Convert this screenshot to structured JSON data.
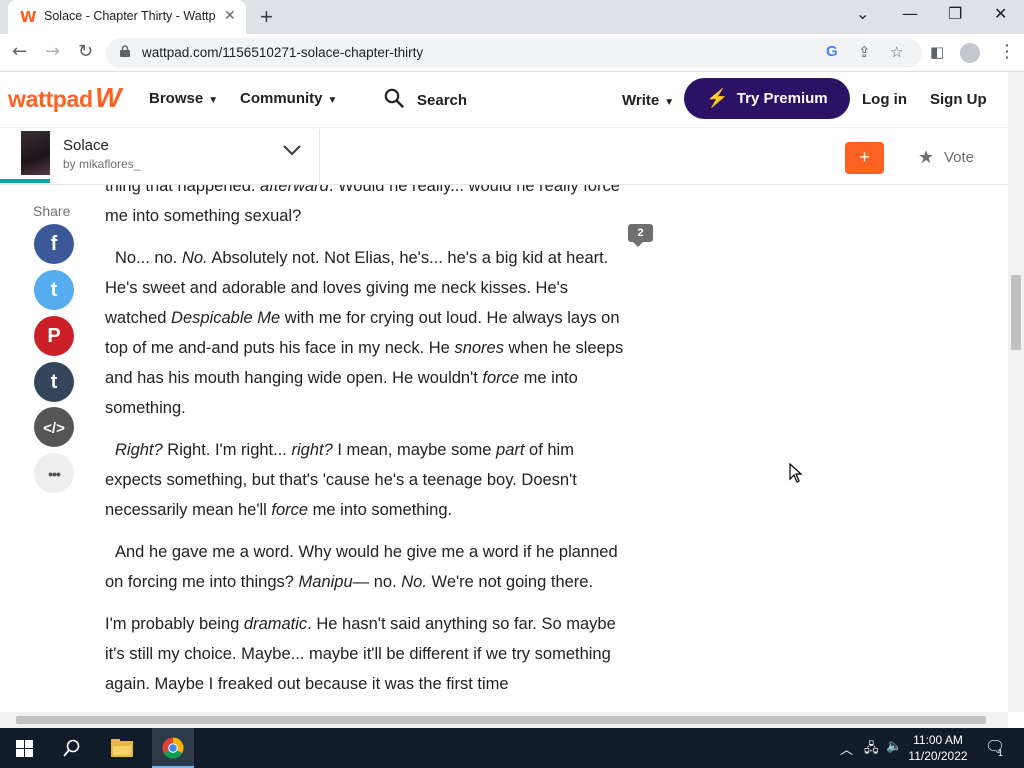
{
  "browser": {
    "tab_title": "Solace - Chapter Thirty - Wattpad",
    "tab_favicon": "W",
    "url": "wattpad.com/1156510271-solace-chapter-thirty"
  },
  "header": {
    "logo_text": "wattpad",
    "logo_w": "W",
    "nav": [
      "Browse",
      "Community"
    ],
    "search_label": "Search",
    "write_label": "Write",
    "premium_label": "Try Premium",
    "login_label": "Log in",
    "signup_label": "Sign Up",
    "brand_color": "#ff6122",
    "premium_color": "#2b1264"
  },
  "story": {
    "title": "Solace",
    "author": "by mikaflores_",
    "vote_label": "Vote",
    "add_label": "+",
    "reading_progress": 0.05
  },
  "share": {
    "label": "Share",
    "buttons": [
      {
        "name": "facebook",
        "glyph": "f",
        "color": "#3b5998"
      },
      {
        "name": "twitter",
        "glyph": "t",
        "color": "#55acee"
      },
      {
        "name": "pinterest",
        "glyph": "P",
        "color": "#cb2027"
      },
      {
        "name": "tumblr",
        "glyph": "t",
        "color": "#35465c"
      },
      {
        "name": "embed",
        "glyph": "</>",
        "color": "#555555"
      },
      {
        "name": "more",
        "glyph": "•••",
        "color": "#eeeeee"
      }
    ]
  },
  "comment_count": "2",
  "paragraphs": [
    {
      "segs": [
        {
          "t": "thing that happened.",
          "i": false
        },
        {
          "t": " ",
          "i": false
        },
        {
          "t": "afterward",
          "i": true
        },
        {
          "t": ". Would he really... would he really force me into something sexual?",
          "i": false
        }
      ]
    },
    {
      "segs": [
        {
          "t": "No... no. ",
          "i": false
        },
        {
          "t": "No.",
          "i": true
        },
        {
          "t": " Absolutely not. Not Elias, he's... he's a big kid at heart. He's sweet and adorable and loves giving me neck kisses. He's watched ",
          "i": false
        },
        {
          "t": "Despicable Me",
          "i": true
        },
        {
          "t": " with me for crying out loud. He always lays on top of me and-and puts his face in my neck. He ",
          "i": false
        },
        {
          "t": "snores",
          "i": true
        },
        {
          "t": " when he sleeps and has his mouth hanging wide open. He wouldn't ",
          "i": false
        },
        {
          "t": "force",
          "i": true
        },
        {
          "t": " me into something.",
          "i": false
        }
      ]
    },
    {
      "segs": [
        {
          "t": "Right?",
          "i": true
        },
        {
          "t": " Right. I'm right... ",
          "i": false
        },
        {
          "t": "right?",
          "i": true
        },
        {
          "t": " I mean, maybe some ",
          "i": false
        },
        {
          "t": "part",
          "i": true
        },
        {
          "t": " of him expects something, but that's 'cause he's a teenage boy. Doesn't necessarily mean he'll ",
          "i": false
        },
        {
          "t": "force",
          "i": true
        },
        {
          "t": " me into something.",
          "i": false
        }
      ]
    },
    {
      "segs": [
        {
          "t": "And he gave me a word. Why would he give me a word if he planned on forcing me into things? ",
          "i": false
        },
        {
          "t": "Manipu—",
          "i": true
        },
        {
          "t": " no. ",
          "i": false
        },
        {
          "t": "No.",
          "i": true
        },
        {
          "t": " We're not going there.",
          "i": false
        }
      ]
    },
    {
      "segs": [
        {
          "t": "I'm probably being ",
          "i": false
        },
        {
          "t": "dramatic",
          "i": true
        },
        {
          "t": ". He hasn't said anything so far. So maybe it's still my choice. Maybe... maybe it'll be different if we try something again. Maybe I freaked out because it was the first time",
          "i": false
        }
      ]
    }
  ],
  "taskbar": {
    "time": "11:00 AM",
    "date": "11/20/2022",
    "notification_count": "1"
  }
}
